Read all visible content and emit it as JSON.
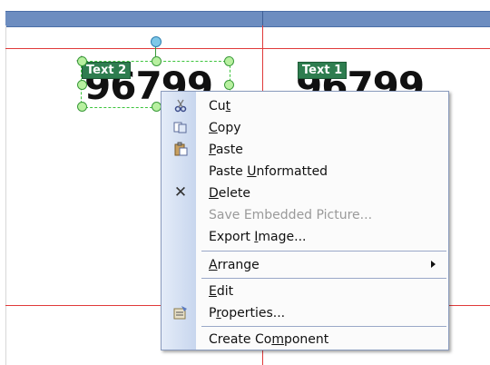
{
  "canvas": {
    "text2": {
      "tag": "Text 2",
      "value": "96799"
    },
    "text1": {
      "tag": "Text 1",
      "value": "96799"
    }
  },
  "menu": {
    "cut": {
      "label_pre": "Cu",
      "label_u": "t",
      "label_post": ""
    },
    "copy": {
      "label_pre": "",
      "label_u": "C",
      "label_post": "opy"
    },
    "paste": {
      "label_pre": "",
      "label_u": "P",
      "label_post": "aste"
    },
    "paste_unformatted": {
      "label_pre": "Paste ",
      "label_u": "U",
      "label_post": "nformatted"
    },
    "delete": {
      "label_pre": "",
      "label_u": "D",
      "label_post": "elete"
    },
    "save_embedded": {
      "label": "Save Embedded Picture..."
    },
    "export_image": {
      "label_pre": "Export ",
      "label_u": "I",
      "label_post": "mage..."
    },
    "arrange": {
      "label_pre": "",
      "label_u": "A",
      "label_post": "rrange"
    },
    "edit": {
      "label_pre": "",
      "label_u": "E",
      "label_post": "dit"
    },
    "properties": {
      "label_pre": "P",
      "label_u": "r",
      "label_post": "operties..."
    },
    "create_component": {
      "label_pre": "Create Co",
      "label_u": "m",
      "label_post": "ponent"
    }
  }
}
